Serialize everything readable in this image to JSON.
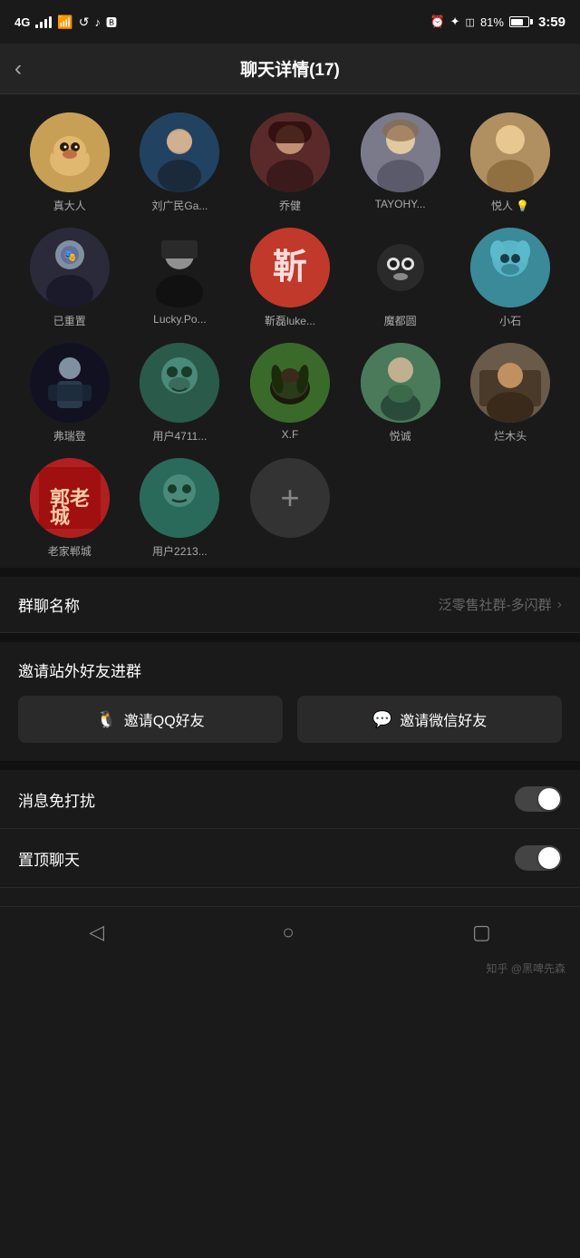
{
  "statusBar": {
    "signal": "4G",
    "wifi": "full",
    "bluetooth": "✦",
    "battery": "81%",
    "time": "3:59",
    "icons": [
      "回",
      "♪",
      "B"
    ]
  },
  "header": {
    "back": "‹",
    "title": "聊天详情(17)"
  },
  "members": [
    {
      "id": 1,
      "name": "真大人",
      "avatar_type": "shiba",
      "label": "🐕"
    },
    {
      "id": 2,
      "name": "刘广民Ga...",
      "avatar_type": "liu",
      "label": "👤"
    },
    {
      "id": 3,
      "name": "乔健",
      "avatar_type": "qiao",
      "label": "👤"
    },
    {
      "id": 4,
      "name": "TAYOHY...",
      "avatar_type": "tayohy",
      "label": "👗"
    },
    {
      "id": 5,
      "name": "悦人 💡",
      "avatar_type": "yue",
      "label": "👘"
    },
    {
      "id": 6,
      "name": "已重置",
      "avatar_type": "chongzhi",
      "label": "🎭"
    },
    {
      "id": 7,
      "name": "Lucky.Po...",
      "avatar_type": "luckypo",
      "label": "🎩"
    },
    {
      "id": 8,
      "name": "靳磊luke...",
      "avatar_type": "xinlei",
      "label": "靳"
    },
    {
      "id": 9,
      "name": "魔都圆",
      "avatar_type": "mogu",
      "label": "🐼"
    },
    {
      "id": 10,
      "name": "小石",
      "avatar_type": "xiaoshi",
      "label": "👾"
    },
    {
      "id": 11,
      "name": "弗瑞登",
      "avatar_type": "fdrui",
      "label": "🏃"
    },
    {
      "id": 12,
      "name": "用户4711...",
      "avatar_type": "yonghu4711",
      "label": "👾"
    },
    {
      "id": 13,
      "name": "X.F",
      "avatar_type": "xf",
      "label": "🐴"
    },
    {
      "id": 14,
      "name": "悦诚",
      "avatar_type": "yuecheng",
      "label": "🚶"
    },
    {
      "id": 15,
      "name": "烂木头",
      "avatar_type": "lamutou",
      "label": "🌄"
    },
    {
      "id": 16,
      "name": "老家郸城",
      "avatar_type": "guolao",
      "label": "郭"
    },
    {
      "id": 17,
      "name": "用户2213...",
      "avatar_type": "yonghu2213",
      "label": "😐"
    }
  ],
  "addButton": {
    "label": "+"
  },
  "settings": {
    "groupName": {
      "label": "群聊名称",
      "value": "泛零售社群-多闪群"
    },
    "inviteTitle": "邀请站外好友进群",
    "inviteQQ": "邀请QQ好友",
    "inviteWeChat": "邀请微信好友",
    "doNotDisturb": {
      "label": "消息免打扰",
      "enabled": false
    },
    "pinChat": {
      "label": "置顶聊天",
      "enabled": false
    }
  },
  "bottomNav": {
    "back": "◁",
    "home": "○",
    "recent": "▢"
  },
  "credit": "知乎 @黑啤先森"
}
